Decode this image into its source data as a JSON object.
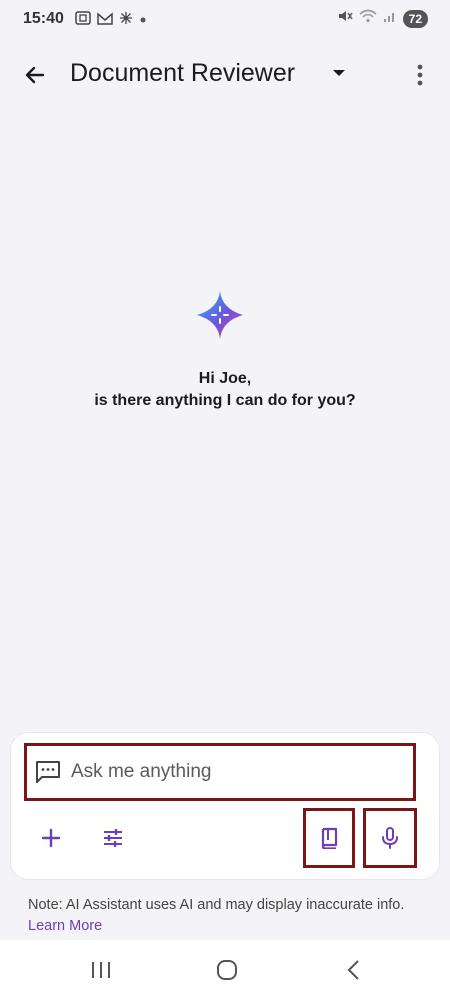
{
  "status_bar": {
    "time": "15:40",
    "battery": "72",
    "left_icons": [
      "screenshot-icon",
      "gmail-icon",
      "pinwheel-icon",
      "dot-icon"
    ],
    "right_icons": [
      "mute-icon",
      "wifi-icon",
      "signal-icon"
    ]
  },
  "app_bar": {
    "title": "Document Reviewer",
    "back_icon": "back-arrow-icon",
    "dropdown_icon": "caret-down-icon",
    "overflow_icon": "more-vert-icon"
  },
  "greeting": {
    "line1": "Hi Joe,",
    "line2": "is there anything I can do for you?"
  },
  "composer": {
    "placeholder": "Ask me anything",
    "tools": [
      "add-icon",
      "tune-icon",
      "book-icon",
      "mic-icon"
    ]
  },
  "note": {
    "text": "Note: AI Assistant uses AI and may display inaccurate info.",
    "link": "Learn More"
  },
  "colors": {
    "accent": "#6b3fb8",
    "highlight_border": "#7a1616",
    "background": "#f4f4f8"
  }
}
